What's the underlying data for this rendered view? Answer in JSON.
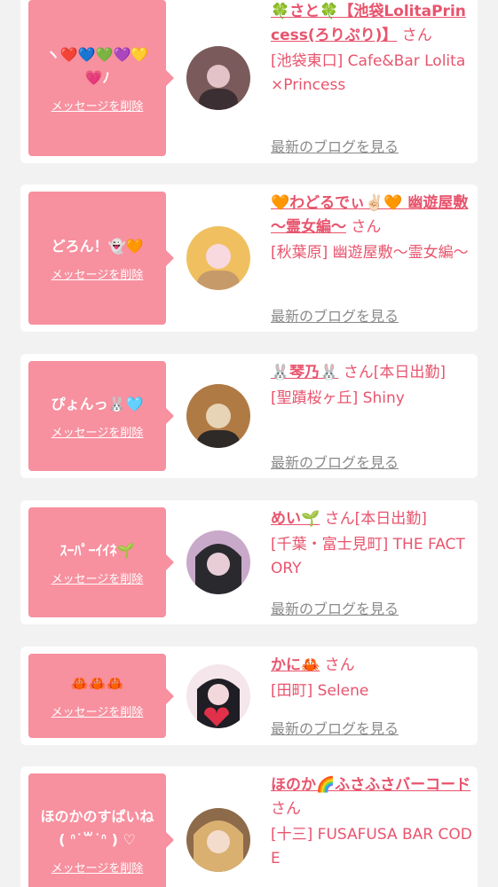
{
  "common": {
    "delete_label": "メッセージを削除",
    "blog_label": "最新のブログを見る",
    "san": "さん"
  },
  "colors": {
    "accent": "#e8546d",
    "bubble": "#f7909f",
    "background": "#f2f2f2",
    "card": "#ffffff"
  },
  "entries": [
    {
      "message": "ヽ❤️💙💚💜💛 💗ﾉ",
      "name": "🍀さと🍀【池袋LolitaPrincess(ろりぷり)】",
      "san_suffix": "",
      "shop": "[池袋東口] Cafe&Bar Lolita×Princess",
      "avatar": [
        "#7a5a5a",
        "#e3c3c8",
        "#3b2f33"
      ]
    },
    {
      "message": "どろん！👻🧡",
      "name": "🧡わどるでぃ✌🏻🧡 幽遊屋敷 〜霊女編〜",
      "san_suffix": "",
      "shop": "[秋葉原] 幽遊屋敷〜霊女編〜",
      "avatar": [
        "#f0c060",
        "#f8d9e0",
        "#c79a6a"
      ]
    },
    {
      "message": "ぴょんっ🐰🩵",
      "name": "🐰琴乃🐰",
      "san_suffix": "[本日出勤]",
      "shop": "[聖蹟桜ヶ丘] Shiny",
      "avatar": [
        "#b07a45",
        "#e7d3b6",
        "#2e2a28"
      ]
    },
    {
      "message": "ｽｰﾊﾟｰｲｲﾈ🌱",
      "name": "めい🌱",
      "san_suffix": "[本日出勤]",
      "shop": "[千葉・富士見町] THE FACTORY",
      "avatar": [
        "#2a2a2e",
        "#e8cdd6",
        "#c9a9c9"
      ]
    },
    {
      "message": "🦀🦀🦀",
      "name": "かに🦀",
      "san_suffix": "",
      "shop": "[田町] Selene",
      "avatar": [
        "#1e1e24",
        "#f2d7dc",
        "#e0304a"
      ]
    },
    {
      "message": "ほのかのすぱいね ( ᐢ˙꒳˙ᐢ ) ♡",
      "name": "ほのか🌈ふさふさバーコード",
      "san_suffix": "",
      "shop": "[十三] FUSAFUSA BAR CODE",
      "avatar": [
        "#d9b070",
        "#f3dccc",
        "#8d6a4a"
      ]
    }
  ]
}
